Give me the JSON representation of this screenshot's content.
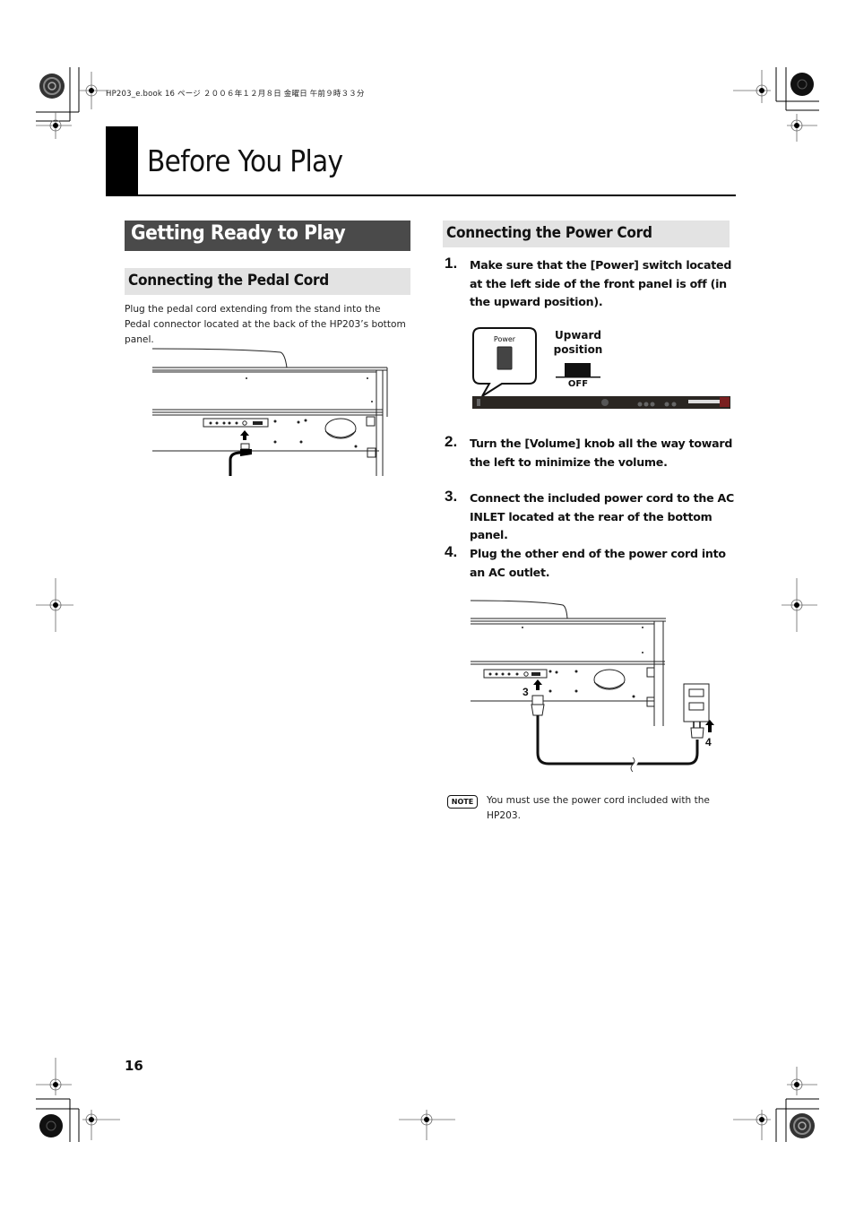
{
  "print_header": "HP203_e.book  16 ページ  ２００６年１２月８日  金曜日  午前９時３３分",
  "chapter": {
    "title": "Before You Play"
  },
  "left_column": {
    "section_title": "Getting Ready to Play",
    "subsection": {
      "title": "Connecting the Pedal Cord",
      "body": "Plug the pedal cord extending from the stand into the Pedal connector located at the back of the HP203’s bottom panel."
    },
    "figure": {
      "name": "pedal-cord-connection-diagram"
    }
  },
  "right_column": {
    "subsection": {
      "title": "Connecting the Power Cord"
    },
    "steps": [
      {
        "number": "1.",
        "text": "Make sure that the [Power] switch located at the left side of the front panel is off (in the upward position)."
      },
      {
        "number": "2.",
        "text": "Turn the [Volume] knob all the way toward the left to minimize the volume."
      },
      {
        "number": "3.",
        "text": "Connect the included power cord to the AC INLET located at the rear of the bottom panel."
      },
      {
        "number": "4.",
        "text": "Plug the other end of the power cord into an AC outlet."
      }
    ],
    "power_figure": {
      "callout_label": "Power",
      "position_label_line1": "Upward",
      "position_label_line2": "position",
      "state_label": "OFF"
    },
    "cord_figure": {
      "callout_3": "3",
      "callout_4": "4"
    },
    "note": {
      "badge": "NOTE",
      "text": "You must use the power cord included with the HP203."
    }
  },
  "footer": {
    "page_number": "16"
  },
  "colors": {
    "section_dark_bg": "#4a4a4a",
    "section_light_bg": "#e3e3e3",
    "text": "#111111"
  }
}
